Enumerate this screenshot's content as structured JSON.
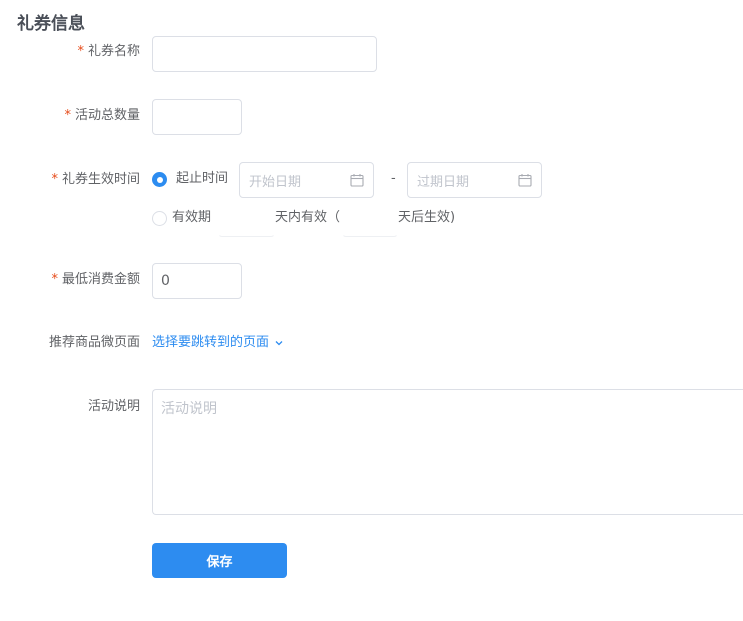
{
  "title": "礼券信息",
  "accent_color": "#2d8cf0",
  "required_mark": "*",
  "fields": {
    "coupon_name": {
      "label": "礼券名称",
      "value": ""
    },
    "total_quantity": {
      "label": "活动总数量",
      "value": ""
    },
    "validity": {
      "label": "礼券生效时间",
      "option_range": {
        "label": "起止时间",
        "checked": true
      },
      "start_date_placeholder": "开始日期",
      "separator": "-",
      "end_date_placeholder": "过期日期",
      "option_period": {
        "label": "有效期",
        "checked": false
      },
      "days_valid_text": "天内有效（",
      "days_after_text": "天后生效)"
    },
    "min_spend": {
      "label": "最低消费金额",
      "value": "0"
    },
    "recommend_page": {
      "label": "推荐商品微页面",
      "link_text": "选择要跳转到的页面"
    },
    "description": {
      "label": "活动说明",
      "placeholder": "活动说明"
    }
  },
  "save_button": "保存",
  "icons": [
    "calendar-icon",
    "chevron-down-icon"
  ]
}
